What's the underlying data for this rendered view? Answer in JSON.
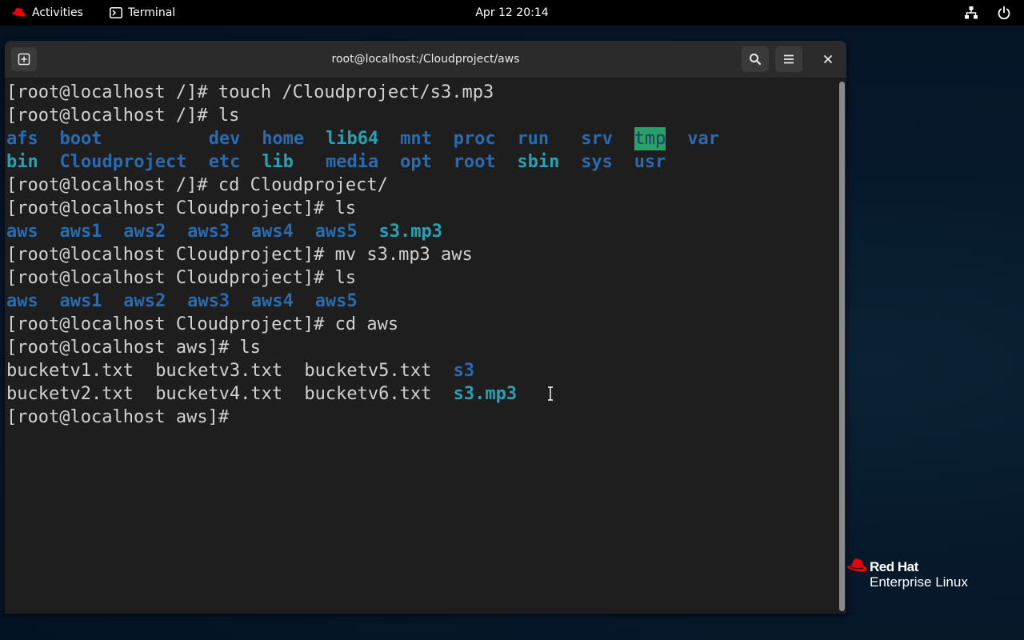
{
  "topbar": {
    "activities_label": "Activities",
    "app_label": "Terminal",
    "clock": "Apr 12  20:14"
  },
  "window": {
    "title": "root@localhost:/Cloudproject/aws"
  },
  "terminal": {
    "lines": [
      [
        {
          "text": "[root@localhost /]# touch /Cloudproject/s3.mp3",
          "style": "plain"
        }
      ],
      [
        {
          "text": "[root@localhost /]# ls",
          "style": "plain"
        }
      ],
      [
        {
          "text": "afs",
          "style": "dir"
        },
        {
          "text": "boot",
          "style": "dir"
        },
        {
          "text": "dev",
          "style": "dir"
        },
        {
          "text": "home",
          "style": "dir"
        },
        {
          "text": "lib64",
          "style": "cyan"
        },
        {
          "text": "mnt",
          "style": "dir"
        },
        {
          "text": "proc",
          "style": "dir"
        },
        {
          "text": "run",
          "style": "dir"
        },
        {
          "text": "srv",
          "style": "dir"
        },
        {
          "text": "tmp",
          "style": "hl"
        },
        {
          "text": "var",
          "style": "dir"
        }
      ],
      [
        {
          "text": "bin",
          "style": "cyan"
        },
        {
          "text": "Cloudproject",
          "style": "dir"
        },
        {
          "text": "etc",
          "style": "dir"
        },
        {
          "text": "lib",
          "style": "cyan"
        },
        {
          "text": "media",
          "style": "dir"
        },
        {
          "text": "opt",
          "style": "dir"
        },
        {
          "text": "root",
          "style": "dir"
        },
        {
          "text": "sbin",
          "style": "cyan"
        },
        {
          "text": "sys",
          "style": "dir"
        },
        {
          "text": "usr",
          "style": "dir"
        }
      ],
      [
        {
          "text": "[root@localhost /]# cd Cloudproject/",
          "style": "plain"
        }
      ],
      [
        {
          "text": "[root@localhost Cloudproject]# ls",
          "style": "plain"
        }
      ],
      [
        {
          "text": "aws",
          "style": "dir"
        },
        {
          "text": "aws1",
          "style": "dir"
        },
        {
          "text": "aws2",
          "style": "dir"
        },
        {
          "text": "aws3",
          "style": "dir"
        },
        {
          "text": "aws4",
          "style": "dir"
        },
        {
          "text": "aws5",
          "style": "dir"
        },
        {
          "text": "s3.mp3",
          "style": "cyan"
        }
      ],
      [
        {
          "text": "[root@localhost Cloudproject]# mv s3.mp3 aws",
          "style": "plain"
        }
      ],
      [
        {
          "text": "[root@localhost Cloudproject]# ls",
          "style": "plain"
        }
      ],
      [
        {
          "text": "aws",
          "style": "dir"
        },
        {
          "text": "aws1",
          "style": "dir"
        },
        {
          "text": "aws2",
          "style": "dir"
        },
        {
          "text": "aws3",
          "style": "dir"
        },
        {
          "text": "aws4",
          "style": "dir"
        },
        {
          "text": "aws5",
          "style": "dir"
        }
      ],
      [
        {
          "text": "[root@localhost Cloudproject]# cd aws",
          "style": "plain"
        }
      ],
      [
        {
          "text": "[root@localhost aws]# ls",
          "style": "plain"
        }
      ],
      [
        {
          "text": "bucketv1.txt",
          "style": "plain"
        },
        {
          "text": "bucketv3.txt",
          "style": "plain"
        },
        {
          "text": "bucketv5.txt",
          "style": "plain"
        },
        {
          "text": "s3",
          "style": "dir"
        }
      ],
      [
        {
          "text": "bucketv2.txt",
          "style": "plain"
        },
        {
          "text": "bucketv4.txt",
          "style": "plain"
        },
        {
          "text": "bucketv6.txt",
          "style": "plain"
        },
        {
          "text": "s3.mp3",
          "style": "cyan"
        }
      ],
      [
        {
          "text": "[root@localhost aws]# ",
          "style": "plain"
        }
      ]
    ]
  },
  "branding": {
    "line1": "Red Hat",
    "line2": "Enterprise Linux"
  },
  "colors": {
    "directory": "#2a6bb0",
    "symlink_or_file": "#2aa1b3",
    "highlight_bg": "#26a269",
    "redhat_red": "#ee0000"
  }
}
